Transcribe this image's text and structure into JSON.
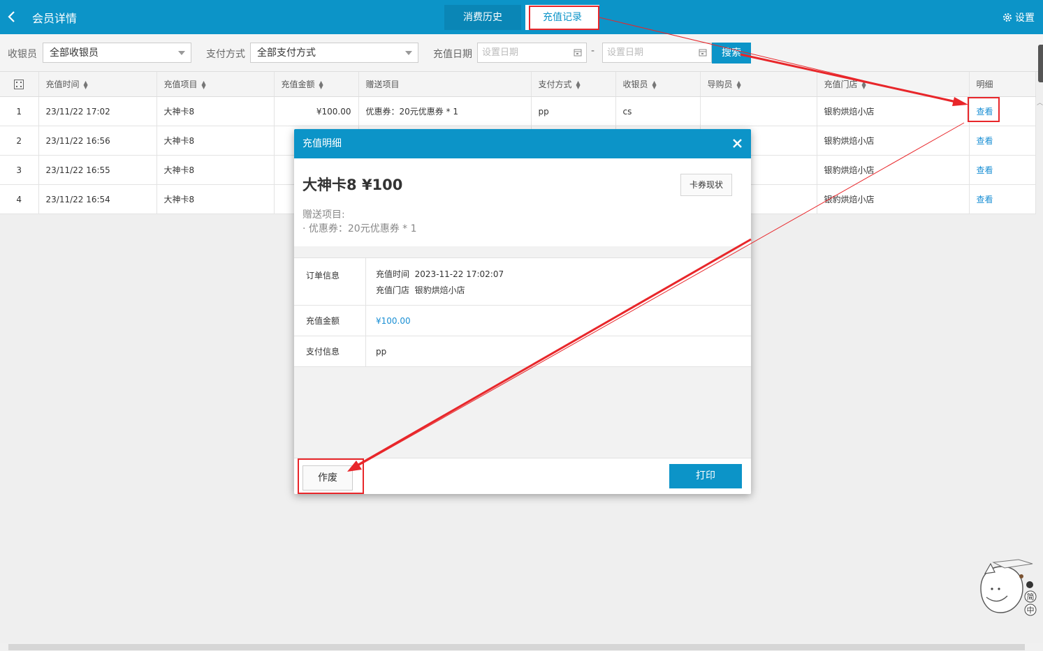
{
  "header": {
    "title": "会员详情",
    "tabs": [
      {
        "label": "消费历史",
        "active": false
      },
      {
        "label": "充值记录",
        "active": true
      }
    ],
    "settings_label": "设置"
  },
  "filters": {
    "cashier_label": "收银员",
    "cashier_value": "全部收银员",
    "payment_label": "支付方式",
    "payment_value": "全部支付方式",
    "date_label": "充值日期",
    "date_start_placeholder": "设置日期",
    "date_separator": "-",
    "date_end_placeholder": "设置日期",
    "search_label": "搜索"
  },
  "table": {
    "columns": [
      "充值时间",
      "充值项目",
      "充值金额",
      "赠送项目",
      "支付方式",
      "收银员",
      "导购员",
      "充值门店",
      "明细"
    ],
    "rows": [
      {
        "no": "1",
        "time": "23/11/22 17:02",
        "item": "大神卡8",
        "amount": "¥100.00",
        "gift": "优惠券：20元优惠券 * 1",
        "payment": "pp",
        "cashier": "cs",
        "guide": "",
        "store": "银豹烘焙小店",
        "detail": "查看"
      },
      {
        "no": "2",
        "time": "23/11/22 16:56",
        "item": "大神卡8",
        "amount": "",
        "gift": "",
        "payment": "",
        "cashier": "",
        "guide": "",
        "store": "银豹烘焙小店",
        "detail": "查看"
      },
      {
        "no": "3",
        "time": "23/11/22 16:55",
        "item": "大神卡8",
        "amount": "",
        "gift": "",
        "payment": "",
        "cashier": "",
        "guide": "",
        "store": "银豹烘焙小店",
        "detail": "查看"
      },
      {
        "no": "4",
        "time": "23/11/22 16:54",
        "item": "大神卡8",
        "amount": "",
        "gift": "",
        "payment": "",
        "cashier": "",
        "guide": "",
        "store": "银豹烘焙小店",
        "detail": "查看"
      }
    ]
  },
  "modal": {
    "title": "充值明细",
    "card_name": "大神卡8",
    "card_amount": "¥100",
    "status_button": "卡券现状",
    "gift_label": "赠送项目:",
    "gift_item": "· 优惠券：20元优惠券 * 1",
    "order_info_label": "订单信息",
    "order_time_label": "充值时间",
    "order_time": "2023-11-22 17:02:07",
    "order_store_label": "充值门店",
    "order_store": "银豹烘焙小店",
    "amount_label": "充值金额",
    "amount_value": "¥100.00",
    "payment_label": "支付信息",
    "payment_value": "pp",
    "void_button": "作废",
    "print_button": "打印"
  },
  "mascot_text": "简中",
  "colors": {
    "primary": "#0c94c8",
    "annotation": "#e8262a",
    "link": "#1a8fd4"
  }
}
